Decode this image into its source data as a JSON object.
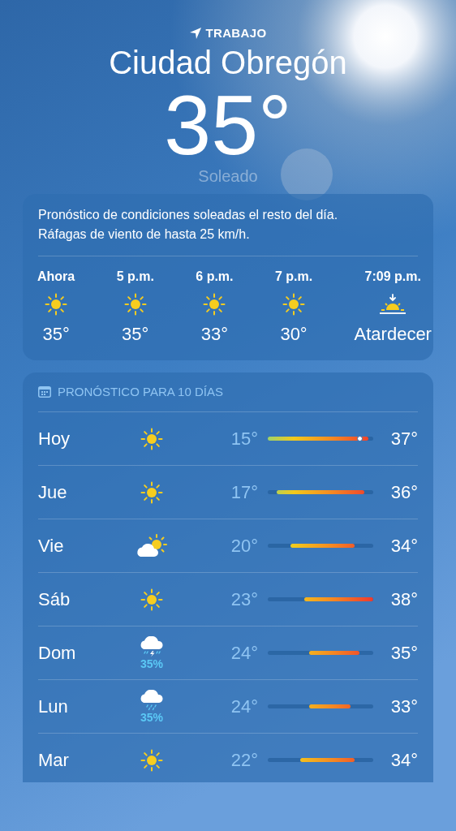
{
  "header": {
    "location_label": "TRABAJO",
    "city": "Ciudad Obregón",
    "temperature": "35°",
    "condition": "Soleado"
  },
  "summary": {
    "text": "Pronóstico de condiciones soleadas el resto del día. Ráfagas de viento de hasta 25 km/h.",
    "hours": [
      {
        "time": "Ahora",
        "kind": "sun",
        "value": "35°"
      },
      {
        "time": "5 p.m.",
        "kind": "sun",
        "value": "35°"
      },
      {
        "time": "6 p.m.",
        "kind": "sun",
        "value": "33°"
      },
      {
        "time": "7 p.m.",
        "kind": "sun",
        "value": "30°"
      },
      {
        "time": "7:09 p.m.",
        "kind": "sunset",
        "value": "Atardecer"
      }
    ]
  },
  "forecast": {
    "title": "PRONÓSTICO PARA 10 DÍAS",
    "days": [
      {
        "day": "Hoy",
        "kind": "sun",
        "low": "15°",
        "high": "37°",
        "now_marker": true
      },
      {
        "day": "Jue",
        "kind": "sun",
        "low": "17°",
        "high": "36°",
        "now_marker": false
      },
      {
        "day": "Vie",
        "kind": "partly_cloudy",
        "low": "20°",
        "high": "34°",
        "now_marker": false
      },
      {
        "day": "Sáb",
        "kind": "sun",
        "low": "23°",
        "high": "38°",
        "now_marker": false
      },
      {
        "day": "Dom",
        "kind": "thunderstorm",
        "precip": "35%",
        "low": "24°",
        "high": "35°",
        "now_marker": false
      },
      {
        "day": "Lun",
        "kind": "rain",
        "precip": "35%",
        "low": "24°",
        "high": "33°",
        "now_marker": false
      },
      {
        "day": "Mar",
        "kind": "sun",
        "low": "22°",
        "high": "34°",
        "now_marker": false
      }
    ]
  }
}
